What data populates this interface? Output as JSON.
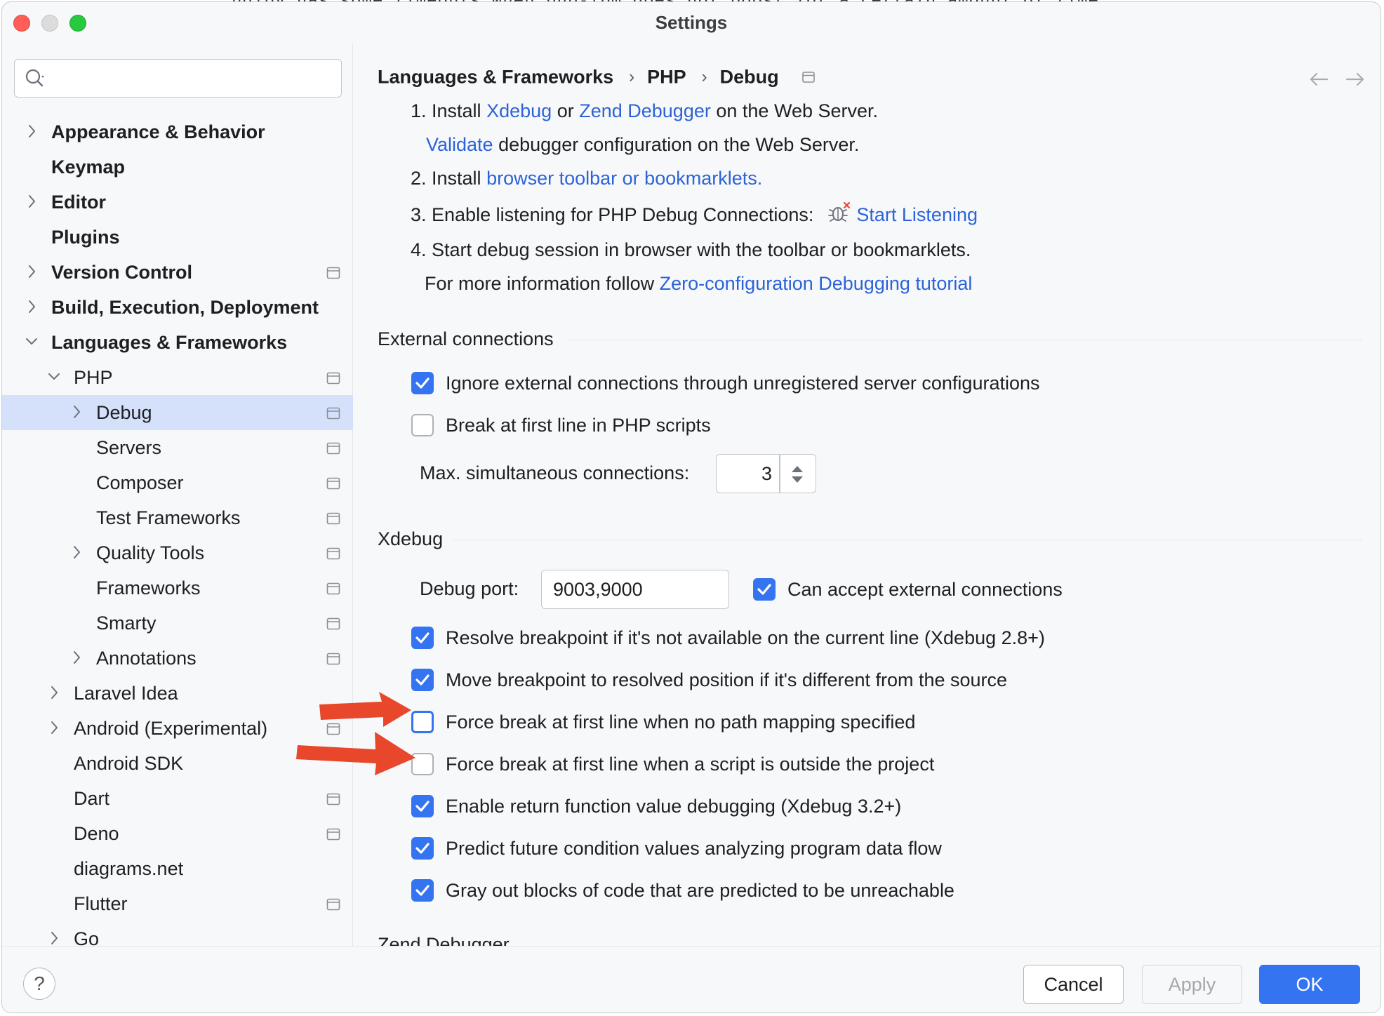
{
  "window": {
    "title": "Settings",
    "background_code": "ndiby has some timeouts when php-fpm does not boost for a certain amount of time"
  },
  "sidebar": {
    "search_placeholder": "",
    "items": [
      {
        "label": "Appearance & Behavior",
        "level": 0,
        "expandable": true,
        "expanded": false,
        "bold": true,
        "project": false
      },
      {
        "label": "Keymap",
        "level": 0,
        "expandable": false,
        "bold": true,
        "project": false
      },
      {
        "label": "Editor",
        "level": 0,
        "expandable": true,
        "expanded": false,
        "bold": true,
        "project": false
      },
      {
        "label": "Plugins",
        "level": 0,
        "expandable": false,
        "bold": true,
        "project": false
      },
      {
        "label": "Version Control",
        "level": 0,
        "expandable": true,
        "expanded": false,
        "bold": true,
        "project": true
      },
      {
        "label": "Build, Execution, Deployment",
        "level": 0,
        "expandable": true,
        "expanded": false,
        "bold": true,
        "project": false
      },
      {
        "label": "Languages & Frameworks",
        "level": 0,
        "expandable": true,
        "expanded": true,
        "bold": true,
        "project": false
      },
      {
        "label": "PHP",
        "level": 1,
        "expandable": true,
        "expanded": true,
        "bold": false,
        "project": true
      },
      {
        "label": "Debug",
        "level": 2,
        "expandable": true,
        "expanded": false,
        "bold": false,
        "project": true,
        "selected": true
      },
      {
        "label": "Servers",
        "level": 2,
        "expandable": false,
        "bold": false,
        "project": true
      },
      {
        "label": "Composer",
        "level": 2,
        "expandable": false,
        "bold": false,
        "project": true
      },
      {
        "label": "Test Frameworks",
        "level": 2,
        "expandable": false,
        "bold": false,
        "project": true
      },
      {
        "label": "Quality Tools",
        "level": 2,
        "expandable": true,
        "expanded": false,
        "bold": false,
        "project": true
      },
      {
        "label": "Frameworks",
        "level": 2,
        "expandable": false,
        "bold": false,
        "project": true
      },
      {
        "label": "Smarty",
        "level": 2,
        "expandable": false,
        "bold": false,
        "project": true
      },
      {
        "label": "Annotations",
        "level": 2,
        "expandable": true,
        "expanded": false,
        "bold": false,
        "project": true
      },
      {
        "label": "Laravel Idea",
        "level": 1,
        "expandable": true,
        "expanded": false,
        "bold": false,
        "project": false
      },
      {
        "label": "Android (Experimental)",
        "level": 1,
        "expandable": true,
        "expanded": false,
        "bold": false,
        "project": true
      },
      {
        "label": "Android SDK",
        "level": 1,
        "expandable": false,
        "bold": false,
        "project": false
      },
      {
        "label": "Dart",
        "level": 1,
        "expandable": false,
        "bold": false,
        "project": true
      },
      {
        "label": "Deno",
        "level": 1,
        "expandable": false,
        "bold": false,
        "project": true
      },
      {
        "label": "diagrams.net",
        "level": 1,
        "expandable": false,
        "bold": false,
        "project": false
      },
      {
        "label": "Flutter",
        "level": 1,
        "expandable": false,
        "bold": false,
        "project": true
      },
      {
        "label": "Go",
        "level": 1,
        "expandable": true,
        "expanded": false,
        "bold": false,
        "project": false
      }
    ]
  },
  "breadcrumb": {
    "items": [
      "Languages & Frameworks",
      "PHP",
      "Debug"
    ],
    "separator": "›"
  },
  "instructions": {
    "step1_prefix": "1. Install",
    "step1_link1": "Xdebug",
    "step1_or": "or",
    "step1_link2": "Zend Debugger",
    "step1_suffix": "on the Web Server.",
    "validate_link": "Validate",
    "validate_suffix": "debugger configuration on the Web Server.",
    "step2_prefix": "2. Install",
    "step2_link": "browser toolbar or bookmarklets.",
    "step3_prefix": "3. Enable listening for PHP Debug Connections:",
    "step3_link": "Start Listening",
    "step4": "4. Start debug session in browser with the toolbar or bookmarklets.",
    "more_prefix": "For more information follow",
    "more_link": "Zero-configuration Debugging tutorial"
  },
  "external": {
    "title": "External connections",
    "ignore_label": "Ignore external connections through unregistered server configurations",
    "ignore_checked": true,
    "break_first_label": "Break at first line in PHP scripts",
    "break_first_checked": false,
    "max_conn_label": "Max. simultaneous connections:",
    "max_conn_value": "3"
  },
  "xdebug": {
    "title": "Xdebug",
    "port_label": "Debug port:",
    "port_value": "9003,9000",
    "accept_label": "Can accept external connections",
    "accept_checked": true,
    "options": [
      {
        "label": "Resolve breakpoint if it's not available on the current line (Xdebug 2.8+)",
        "checked": true
      },
      {
        "label": "Move breakpoint to resolved position if it's different from the source",
        "checked": true
      },
      {
        "label": "Force break at first line when no path mapping specified",
        "checked": false,
        "focused": true
      },
      {
        "label": "Force break at first line when a script is outside the project",
        "checked": false
      },
      {
        "label": "Enable return function value debugging (Xdebug 3.2+)",
        "checked": true
      },
      {
        "label": "Predict future condition values analyzing program data flow",
        "checked": true
      },
      {
        "label": "Gray out blocks of code that are predicted to be unreachable",
        "checked": true
      }
    ],
    "next_section_partial": "Zend Debugger"
  },
  "footer": {
    "help_label": "?",
    "cancel_label": "Cancel",
    "apply_label": "Apply",
    "ok_label": "OK"
  },
  "colors": {
    "accent": "#3574f0",
    "link": "#2c63d8",
    "selection": "#d5e1fb",
    "annotation_arrow": "#e8472b"
  }
}
